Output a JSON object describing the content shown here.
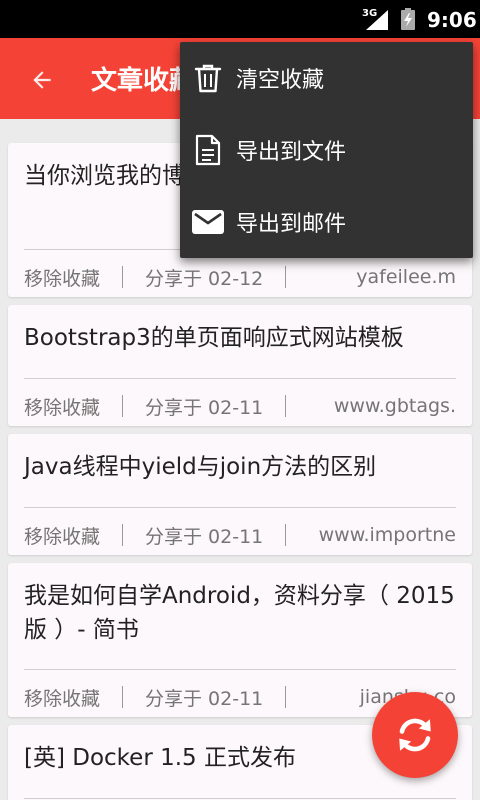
{
  "status_bar": {
    "network": "3G",
    "time": "9:06"
  },
  "app_bar": {
    "title": "文章收藏",
    "back_icon": "arrow-back-icon",
    "color": "#f44336"
  },
  "menu": {
    "items": [
      {
        "label": "清空收藏",
        "icon": "trash-icon"
      },
      {
        "label": "导出到文件",
        "icon": "document-icon"
      },
      {
        "label": "导出到邮件",
        "icon": "email-icon"
      }
    ]
  },
  "articles": [
    {
      "title": "当你浏览我的博客时你在想什么？",
      "remove": "移除收藏",
      "date": "分享于 02-12",
      "source": "yafeilee.m"
    },
    {
      "title": "Bootstrap3的单页面响应式网站模板",
      "remove": "移除收藏",
      "date": "分享于 02-11",
      "source": "www.gbtags."
    },
    {
      "title": "Java线程中yield与join方法的区别",
      "remove": "移除收藏",
      "date": "分享于 02-11",
      "source": "www.importne"
    },
    {
      "title": "我是如何自学Android，资料分享（ 2015 版 ）- 简书",
      "remove": "移除收藏",
      "date": "分享于 02-11",
      "source": "jianshu.co"
    },
    {
      "title": "[英] Docker 1.5 正式发布",
      "remove": "",
      "date": "",
      "source": ""
    }
  ],
  "fab": {
    "icon": "refresh-icon"
  }
}
